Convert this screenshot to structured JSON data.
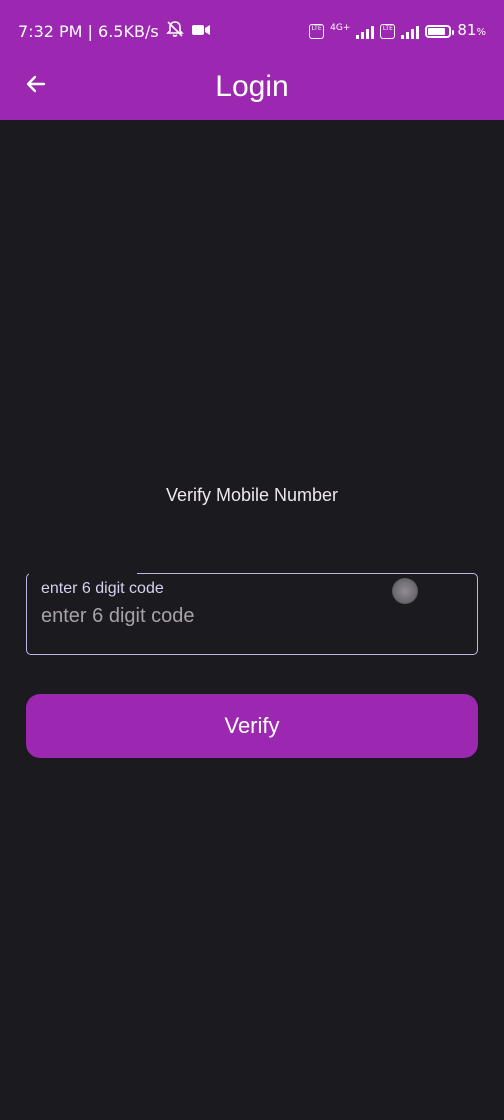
{
  "status_bar": {
    "time_speed": "7:32 PM | 6.5KB/s",
    "mute_icon": "bell-off-icon",
    "video_icon": "video-camera-icon",
    "volte_label": "Vo LTE",
    "network_type": "4G+",
    "battery_percent": "81",
    "battery_level": 0.81
  },
  "app_bar": {
    "title": "Login",
    "back_icon": "arrow-left-icon",
    "color": "#9c27b0"
  },
  "main": {
    "heading": "Verify Mobile Number",
    "code_field": {
      "label": "enter 6 digit code",
      "placeholder": "enter 6 digit code",
      "value": ""
    },
    "verify_button": {
      "label": "Verify"
    }
  },
  "colors": {
    "accent": "#9c27b0",
    "background": "#1b1a1f",
    "field_border": "#bcb7ea"
  }
}
